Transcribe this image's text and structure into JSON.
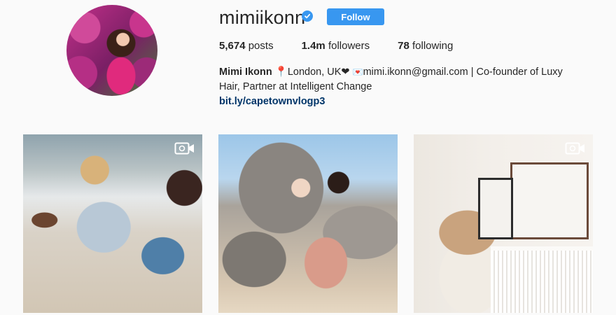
{
  "profile": {
    "username": "mimiikonn",
    "verified": true,
    "follow_label": "Follow",
    "stats": {
      "posts_value": "5,674",
      "posts_label": "posts",
      "followers_value": "1.4m",
      "followers_label": "followers",
      "following_value": "78",
      "following_label": "following"
    },
    "bio": {
      "full_name": "Mimi Ikonn",
      "location": "London, UK",
      "email": "mimi.ikonn@gmail.com",
      "description_1": "| Co-founder of Luxy",
      "description_2": "Hair, Partner at Intelligent Change",
      "link": "bit.ly/capetownvlogp3"
    }
  },
  "posts": [
    {
      "type": "video",
      "icon": "video-camera-icon"
    },
    {
      "type": "photo"
    },
    {
      "type": "video",
      "icon": "video-camera-icon"
    }
  ],
  "colors": {
    "accent": "#3897f0",
    "link": "#003569",
    "background": "#fafafa",
    "text": "#262626"
  }
}
